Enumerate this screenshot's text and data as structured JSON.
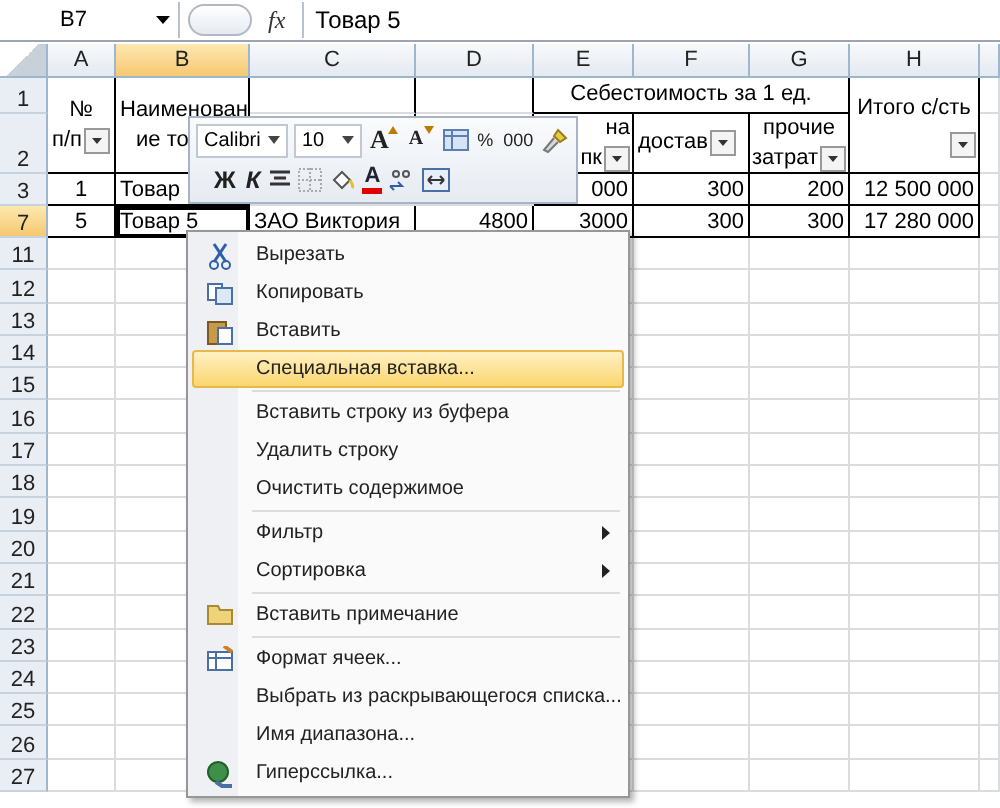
{
  "formula_bar": {
    "name_box": "B7",
    "function_label": "fx",
    "value": "Товар 5"
  },
  "sheet": {
    "columns": [
      {
        "label": "A",
        "selected": false
      },
      {
        "label": "B",
        "selected": true
      },
      {
        "label": "C",
        "selected": false
      },
      {
        "label": "D",
        "selected": false
      },
      {
        "label": "E",
        "selected": false
      },
      {
        "label": "F",
        "selected": false
      },
      {
        "label": "G",
        "selected": false
      },
      {
        "label": "H",
        "selected": false
      }
    ],
    "rows": [
      {
        "label": "1",
        "selected": false
      },
      {
        "label": "2",
        "selected": false
      },
      {
        "label": "3",
        "selected": false
      },
      {
        "label": "7",
        "selected": true
      },
      {
        "label": "11",
        "selected": false
      },
      {
        "label": "12",
        "selected": false
      },
      {
        "label": "13",
        "selected": false
      },
      {
        "label": "14",
        "selected": false
      },
      {
        "label": "15",
        "selected": false
      },
      {
        "label": "16",
        "selected": false
      },
      {
        "label": "17",
        "selected": false
      },
      {
        "label": "18",
        "selected": false
      },
      {
        "label": "19",
        "selected": false
      },
      {
        "label": "20",
        "selected": false
      },
      {
        "label": "21",
        "selected": false
      },
      {
        "label": "22",
        "selected": false
      },
      {
        "label": "23",
        "selected": false
      },
      {
        "label": "24",
        "selected": false
      },
      {
        "label": "25",
        "selected": false
      },
      {
        "label": "26",
        "selected": false
      },
      {
        "label": "27",
        "selected": false
      }
    ],
    "header_cells": [
      {
        "lines": [
          "№",
          "п/п"
        ],
        "filter": true
      },
      {
        "lines": [
          "Наименован",
          "ие то"
        ],
        "filter": false
      },
      {
        "lines": [
          "Себестоимость за 1 ед."
        ],
        "filter": false
      },
      {
        "lines": [
          "на",
          "пк"
        ],
        "filter": true
      },
      {
        "lines": [
          "достав"
        ],
        "filter": true
      },
      {
        "lines": [
          "прочие",
          "затрат"
        ],
        "filter": true
      },
      {
        "lines": [
          "Итого с/сть"
        ],
        "filter": true
      }
    ],
    "data_rows": [
      {
        "cells": [
          {
            "text": "1",
            "selected": false
          },
          {
            "text": "Товар",
            "selected": false
          },
          null,
          null,
          {
            "text": "000",
            "selected": false
          },
          {
            "text": "300",
            "selected": false
          },
          {
            "text": "200",
            "selected": false
          },
          {
            "text": "12 500 000",
            "selected": false
          }
        ]
      },
      {
        "cells": [
          {
            "text": "5",
            "selected": false
          },
          {
            "text": "Товар 5",
            "selected": true
          },
          {
            "text": "ЗАО Виктория",
            "selected": false
          },
          {
            "text": "4800",
            "selected": false
          },
          {
            "text": "3000",
            "selected": false
          },
          {
            "text": "300",
            "selected": false
          },
          {
            "text": "300",
            "selected": false
          },
          {
            "text": "17 280 000",
            "selected": false
          }
        ]
      }
    ]
  },
  "mini_toolbar": {
    "font": "Calibri",
    "size": "10",
    "buttons": [
      {
        "kind": "grow-font",
        "label": "A"
      },
      {
        "kind": "shrink-font",
        "label": "A"
      },
      {
        "kind": "styles"
      },
      {
        "kind": "percent",
        "label": "%"
      },
      {
        "kind": "thousands",
        "label": "000"
      },
      {
        "kind": "brush"
      },
      {
        "kind": "bold",
        "label": "Ж"
      },
      {
        "kind": "italic",
        "label": "К"
      },
      {
        "kind": "center"
      },
      {
        "kind": "borders"
      },
      {
        "kind": "fill"
      },
      {
        "kind": "font-color",
        "label": "A"
      },
      {
        "kind": "decimal"
      },
      {
        "kind": "merge"
      }
    ]
  },
  "context_menu": [
    {
      "label": "Вырезать",
      "kind": "item",
      "selected": false,
      "separator_before": false
    },
    {
      "label": "Копировать",
      "kind": "item",
      "selected": false,
      "separator_before": false
    },
    {
      "label": "Вставить",
      "kind": "item",
      "selected": false,
      "separator_before": false
    },
    {
      "label": "Специальная вставка...",
      "kind": "item",
      "selected": true,
      "separator_before": false
    },
    {
      "label": "Вставить строку из буфера",
      "kind": "item",
      "selected": false,
      "separator_before": true
    },
    {
      "label": "Удалить строку",
      "kind": "item",
      "selected": false,
      "separator_before": false
    },
    {
      "label": "Очистить содержимое",
      "kind": "item",
      "selected": false,
      "separator_before": false
    },
    {
      "label": "Фильтр",
      "kind": "submenu",
      "selected": false,
      "separator_before": true
    },
    {
      "label": "Сортировка",
      "kind": "submenu",
      "selected": false,
      "separator_before": false
    },
    {
      "label": "Вставить примечание",
      "kind": "item",
      "selected": false,
      "separator_before": true
    },
    {
      "label": "Формат ячеек...",
      "kind": "item",
      "selected": false,
      "separator_before": true
    },
    {
      "label": "Выбрать из раскрывающегося списка...",
      "kind": "item",
      "selected": false,
      "separator_before": false
    },
    {
      "label": "Имя диапазона...",
      "kind": "item",
      "selected": false,
      "separator_before": false
    },
    {
      "label": "Гиперссылка...",
      "kind": "item",
      "selected": false,
      "separator_before": false
    }
  ]
}
